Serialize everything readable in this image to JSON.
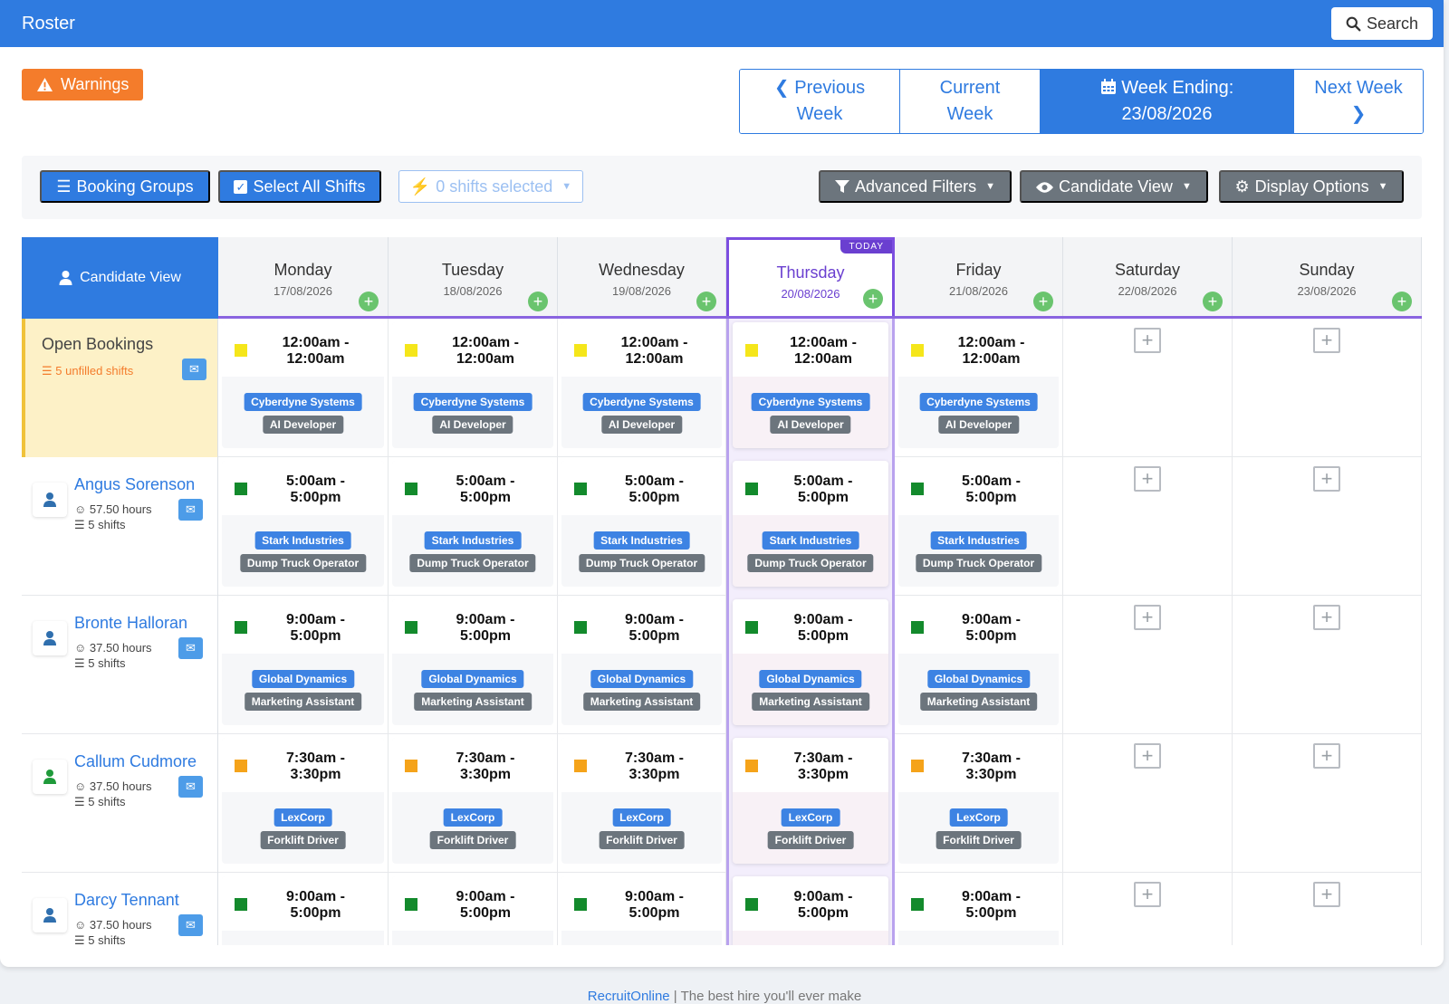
{
  "header": {
    "title": "Roster",
    "search_label": "Search"
  },
  "warnings_label": "Warnings",
  "weeknav": {
    "prev_line1": "Previous",
    "prev_line2": "Week",
    "current_line1": "Current",
    "current_line2": "Week",
    "ending_line1": "Week Ending:",
    "ending_line2": "23/08/2026",
    "next_line1": "Next Week"
  },
  "toolbar": {
    "booking_groups": "Booking Groups",
    "select_all": "Select All Shifts",
    "shifts_selected": "0 shifts selected",
    "advanced_filters": "Advanced Filters",
    "candidate_view": "Candidate View",
    "display_options": "Display Options"
  },
  "grid": {
    "corner_label": "Candidate View",
    "today_badge": "TODAY",
    "days": [
      {
        "name": "Monday",
        "date": "17/08/2026"
      },
      {
        "name": "Tuesday",
        "date": "18/08/2026"
      },
      {
        "name": "Wednesday",
        "date": "19/08/2026"
      },
      {
        "name": "Thursday",
        "date": "20/08/2026"
      },
      {
        "name": "Friday",
        "date": "21/08/2026"
      },
      {
        "name": "Saturday",
        "date": "22/08/2026"
      },
      {
        "name": "Sunday",
        "date": "23/08/2026"
      }
    ],
    "open_bookings": {
      "title": "Open Bookings",
      "subtitle": "5 unfilled shifts",
      "shift": {
        "time_line1": "12:00am -",
        "time_line2": "12:00am",
        "client": "Cyberdyne Systems",
        "role": "AI Developer",
        "color": "#f5e61a"
      }
    },
    "candidates": [
      {
        "name": "Angus Sorenson",
        "hours": "57.50 hours",
        "shifts": "5 shifts",
        "avatar_color": "#2f6fae",
        "shift": {
          "time_line1": "5:00am -",
          "time_line2": "5:00pm",
          "client": "Stark Industries",
          "role": "Dump Truck Operator",
          "color": "#138a2c"
        }
      },
      {
        "name": "Bronte Halloran",
        "hours": "37.50 hours",
        "shifts": "5 shifts",
        "avatar_color": "#2f6fae",
        "shift": {
          "time_line1": "9:00am -",
          "time_line2": "5:00pm",
          "client": "Global Dynamics",
          "role": "Marketing Assistant",
          "color": "#138a2c"
        }
      },
      {
        "name": "Callum Cudmore",
        "hours": "37.50 hours",
        "shifts": "5 shifts",
        "avatar_color": "#1f9a3a",
        "shift": {
          "time_line1": "7:30am -",
          "time_line2": "3:30pm",
          "client": "LexCorp",
          "role": "Forklift Driver",
          "color": "#f5a31a"
        }
      },
      {
        "name": "Darcy Tennant",
        "hours": "37.50 hours",
        "shifts": "5 shifts",
        "avatar_color": "#2f6fae",
        "shift": {
          "time_line1": "9:00am -",
          "time_line2": "5:00pm",
          "client": "",
          "role": "",
          "color": "#138a2c"
        }
      }
    ]
  },
  "footer": {
    "brand": "RecruitOnline",
    "tagline": " | The best hire you'll ever make"
  },
  "colors": {
    "primary": "#2f7be0",
    "today": "#6a3fd0",
    "warning": "#f47c2b",
    "add": "#6ac46e"
  }
}
